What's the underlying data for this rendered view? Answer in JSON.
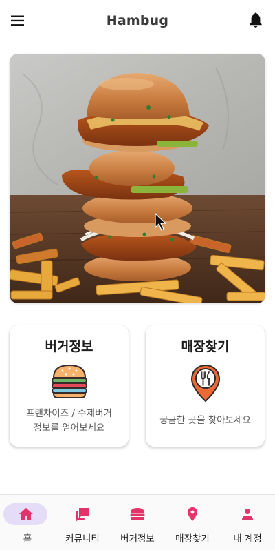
{
  "app": {
    "title": "Hambug",
    "accent_color": "#e2336b",
    "nav_active_bg": "#e5ddf7"
  },
  "header": {
    "menu_icon": "menu-icon",
    "notification_icon": "bell-icon"
  },
  "hero": {
    "image": "stacked-fried-chicken-burger-with-fries"
  },
  "cards": [
    {
      "title": "버거정보",
      "icon": "burger-icon",
      "description_lines": [
        "프랜차이즈 / 수제버거",
        "정보를 얻어보세요"
      ]
    },
    {
      "title": "매장찾기",
      "icon": "location-pin-utensils-icon",
      "description_lines": [
        "궁금한 곳을 찾아보세요"
      ]
    }
  ],
  "bottom_nav": {
    "active_index": 0,
    "items": [
      {
        "label": "홈",
        "icon": "home-icon"
      },
      {
        "label": "커뮤니티",
        "icon": "chat-bubbles-icon"
      },
      {
        "label": "버거정보",
        "icon": "burger-icon"
      },
      {
        "label": "매장찾기",
        "icon": "location-pin-icon"
      },
      {
        "label": "내 계정",
        "icon": "person-icon"
      }
    ]
  }
}
